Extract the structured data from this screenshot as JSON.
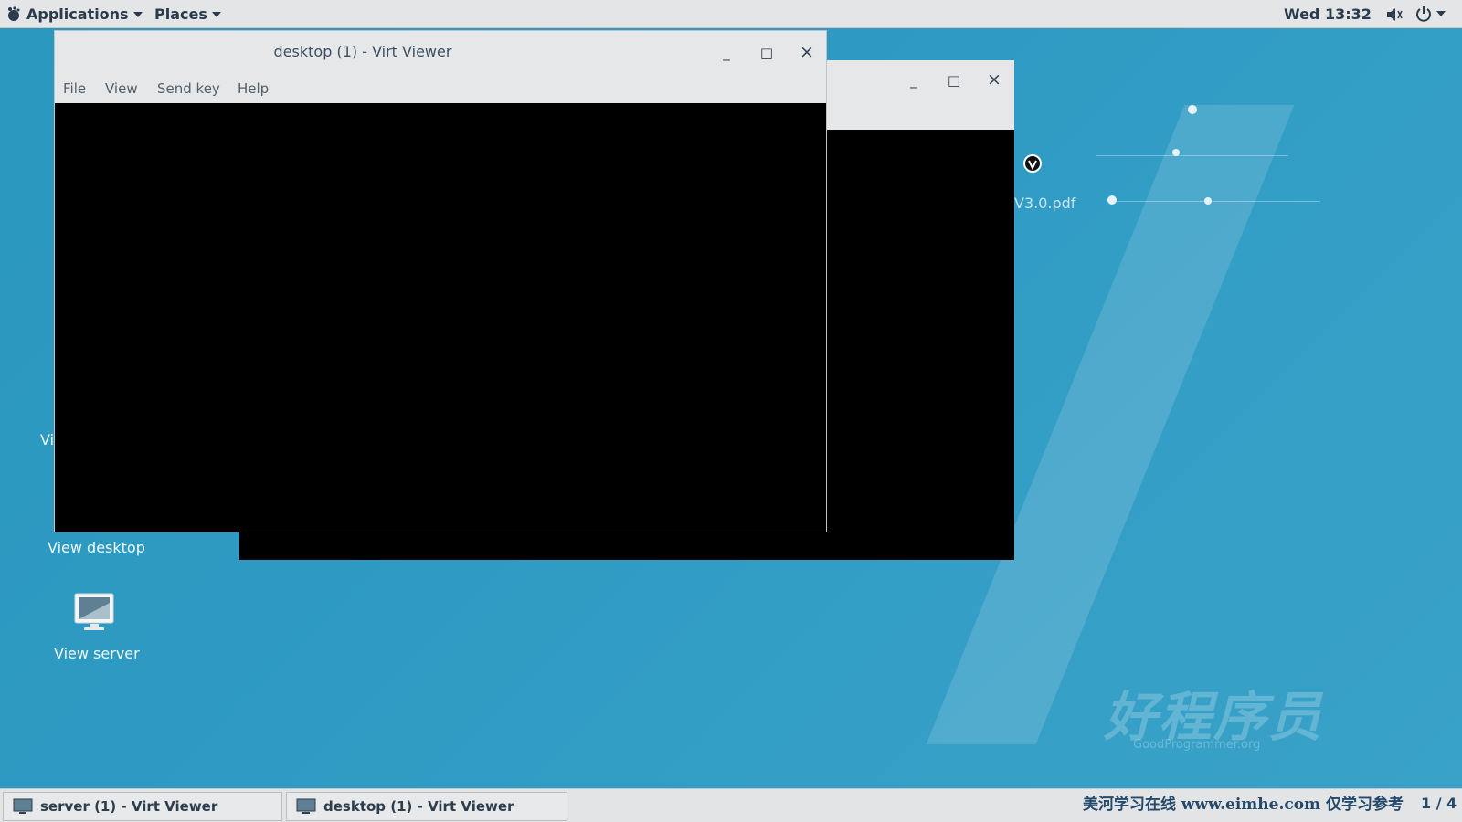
{
  "topbar": {
    "applications": "Applications",
    "places": "Places",
    "clock": "Wed 13:32"
  },
  "front_window": {
    "title": "desktop (1) - Virt Viewer",
    "menu": [
      "File",
      "View",
      "Send key",
      "Help"
    ],
    "minimize": "_",
    "maximize": "□",
    "close": "×"
  },
  "back_window": {
    "minimize": "_",
    "maximize": "□",
    "close": "×"
  },
  "desktop": {
    "label_vi": "Vi",
    "pdf_label": "V3.0.pdf",
    "view_desktop": "View desktop",
    "view_server": "View server"
  },
  "taskbar": {
    "tasks": [
      "server (1) - Virt Viewer",
      "desktop (1) - Virt Viewer"
    ],
    "watermark": "美河学习在线 www.eimhe.com 仅学习参考",
    "pager": "1 / 4"
  },
  "wallpaper": {
    "logo": "好程序员",
    "logo_sub": "GoodProgrammer.org"
  }
}
